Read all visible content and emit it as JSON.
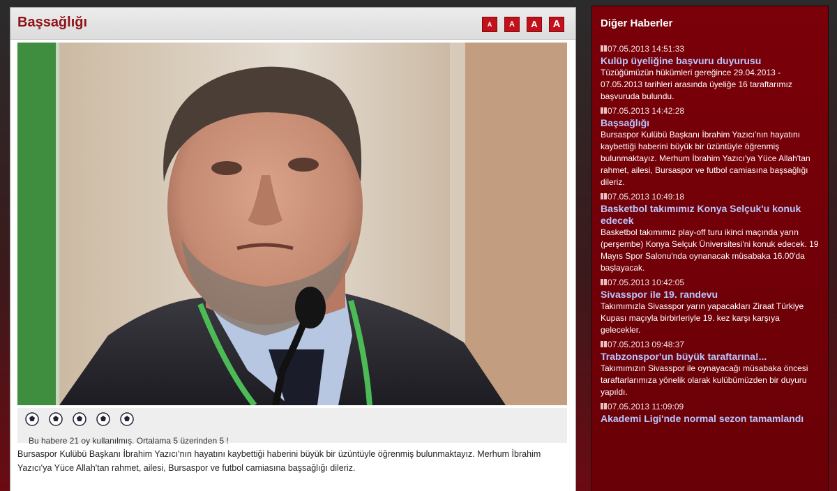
{
  "article": {
    "title": "Başsağlığı",
    "font_buttons": [
      "A",
      "A",
      "A",
      "A"
    ],
    "rating_text": "Bu habere 21 oy kullanılmış. Ortalama 5 üzerinden 5 !",
    "body": "Bursaspor Kulübü Başkanı İbrahim Yazıcı'nın hayatını kaybettiği haberini büyük bir üzüntüyle öğrenmiş bulunmaktayız. Merhum İbrahim Yazıcı'ya Yüce Allah'tan rahmet, ailesi, Bursaspor ve futbol camiasına başsağlığı dileriz.",
    "stars": 5
  },
  "sidebar": {
    "title": "Diğer Haberler",
    "items": [
      {
        "date": "07.05.2013 14:51:33",
        "headline": "Kulüp üyeliğine başvuru duyurusu",
        "summary": "Tüzüğümüzün hükümleri gereğince 29.04.2013 - 07.05.2013 tarihleri arasında üyeliğe 16 taraftarımız başvuruda bulundu."
      },
      {
        "date": "07.05.2013 14:42:28",
        "headline": "Başsağlığı",
        "summary": "Bursaspor Kulübü Başkanı İbrahim Yazıcı'nın hayatını kaybettiği haberini büyük bir üzüntüyle öğrenmiş bulunmaktayız. Merhum İbrahim Yazıcı'ya Yüce Allah'tan rahmet, ailesi, Bursaspor ve futbol camiasına başsağlığı dileriz."
      },
      {
        "date": "07.05.2013 10:49:18",
        "headline": "Basketbol takımımız Konya Selçuk'u konuk edecek",
        "summary": "Basketbol takımımız play-off turu ikinci maçında yarın (perşembe) Konya Selçuk Üniversitesi'ni konuk edecek. 19 Mayıs Spor Salonu'nda oynanacak müsabaka 16.00'da başlayacak."
      },
      {
        "date": "07.05.2013 10:42:05",
        "headline": "Sivasspor ile 19. randevu",
        "summary": "Takımımızla Sivasspor yarın yapacakları Ziraat Türkiye Kupası maçıyla birbirleriyle 19. kez karşı karşıya gelecekler."
      },
      {
        "date": "07.05.2013 09:48:37",
        "headline": "Trabzonspor'un büyük taraftarına!...",
        "summary": "Takımımızın Sivasspor ile oynayacağı müsabaka öncesi taraftarlarımıza yönelik olarak kulübümüzden bir duyuru yapıldı."
      },
      {
        "date": "07.05.2013 11:09:09",
        "headline": "Akademi Ligi'nde normal sezon tamamlandı",
        "summary": ""
      }
    ]
  },
  "colors": {
    "title_red": "#8e1218",
    "button_red": "#c3111c",
    "sidebar_bg": "#6b0007",
    "link_blue": "#b9c6ff"
  }
}
